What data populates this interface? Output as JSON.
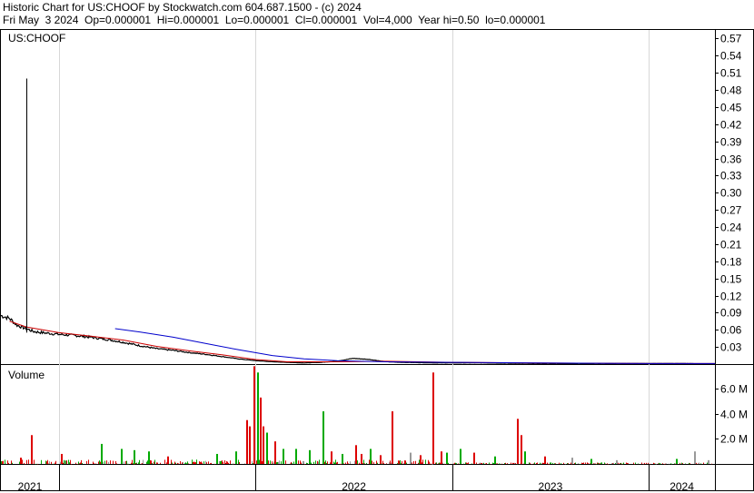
{
  "header": {
    "line1": "Historic Chart for US:CHOOF by Stockwatch.com 604.687.1500 - (c) 2024",
    "line2": "Fri May  3 2024  Op=0.000001  Hi=0.000001  Lo=0.000001  Cl=0.000001  Vol=4,000  Year hi=0.50  lo=0.000001"
  },
  "chart_data": [
    {
      "type": "line",
      "panel": "price",
      "label": "US:CHOOF",
      "ylim": [
        0,
        0.585
      ],
      "yticks": [
        "0.57",
        "0.54",
        "0.51",
        "0.48",
        "0.45",
        "0.42",
        "0.39",
        "0.36",
        "0.33",
        "0.30",
        "0.27",
        "0.24",
        "0.21",
        "0.18",
        "0.15",
        "0.12",
        "0.09",
        "0.06",
        "0.03"
      ],
      "ytick_values": [
        0.57,
        0.54,
        0.51,
        0.48,
        0.45,
        0.42,
        0.39,
        0.36,
        0.33,
        0.3,
        0.27,
        0.24,
        0.21,
        0.18,
        0.15,
        0.12,
        0.09,
        0.06,
        0.03
      ],
      "xlim": [
        "2020-09-15",
        "2024-05-03"
      ],
      "spike": {
        "x": "2020-11-02",
        "low": 0.055,
        "high": 0.5
      },
      "series": [
        {
          "name": "",
          "color": "#000000",
          "x": [
            "2020-09-15",
            "2020-10-01",
            "2020-10-15",
            "2020-11-01",
            "2020-11-15",
            "2020-12-01",
            "2021-01-01",
            "2021-02-01",
            "2021-03-01",
            "2021-04-01",
            "2021-05-01",
            "2021-06-01",
            "2021-07-01",
            "2021-08-01",
            "2021-09-01",
            "2021-10-01",
            "2021-11-01",
            "2021-12-01",
            "2022-01-01",
            "2022-02-01",
            "2022-03-01",
            "2022-04-01",
            "2022-05-01",
            "2022-06-01",
            "2022-07-01",
            "2022-08-01",
            "2022-09-01",
            "2022-10-01",
            "2022-12-01",
            "2023-03-01",
            "2023-06-01",
            "2023-09-01",
            "2023-12-01",
            "2024-03-01",
            "2024-05-03"
          ],
          "values": [
            0.085,
            0.08,
            0.068,
            0.062,
            0.057,
            0.055,
            0.052,
            0.05,
            0.047,
            0.043,
            0.038,
            0.032,
            0.027,
            0.024,
            0.02,
            0.017,
            0.013,
            0.009,
            0.006,
            0.004,
            0.003,
            0.002,
            0.003,
            0.005,
            0.01,
            0.008,
            0.004,
            0.003,
            0.002,
            0.002,
            0.001,
            0.001,
            0.001,
            0.001,
            1e-06
          ]
        },
        {
          "name": "",
          "color": "#cc0000",
          "x": [
            "2020-10-01",
            "2020-11-01",
            "2021-01-01",
            "2021-03-01",
            "2021-05-01",
            "2021-07-01",
            "2021-09-01",
            "2021-11-01",
            "2022-01-01",
            "2022-03-01",
            "2022-06-01",
            "2022-09-01",
            "2023-01-01",
            "2023-06-01",
            "2024-01-01",
            "2024-05-03"
          ],
          "values": [
            0.075,
            0.065,
            0.055,
            0.049,
            0.042,
            0.031,
            0.023,
            0.016,
            0.008,
            0.004,
            0.004,
            0.005,
            0.003,
            0.002,
            0.001,
            0.001
          ]
        },
        {
          "name": "",
          "color": "#0000cc",
          "x": [
            "2021-04-15",
            "2021-06-01",
            "2021-08-01",
            "2021-10-01",
            "2021-12-01",
            "2022-02-01",
            "2022-04-01",
            "2022-06-01",
            "2022-09-01",
            "2023-01-01",
            "2023-06-01",
            "2024-01-01",
            "2024-05-03"
          ],
          "values": [
            0.062,
            0.056,
            0.047,
            0.036,
            0.025,
            0.015,
            0.009,
            0.006,
            0.004,
            0.003,
            0.002,
            0.001,
            0.001
          ]
        }
      ]
    },
    {
      "type": "bar",
      "panel": "volume",
      "label": "Volume",
      "ylim": [
        0,
        7.9
      ],
      "unit": "M",
      "yticks": [
        "6.0 M",
        "4.0 M",
        "2.0 M"
      ],
      "ytick_values": [
        6.0,
        4.0,
        2.0
      ],
      "xlim": [
        "2020-09-15",
        "2024-05-03"
      ],
      "colors": {
        "up": "#00aa00",
        "down": "#dd0000",
        "flat": "#999999"
      },
      "peaks": [
        {
          "x": "2020-10-20",
          "v": 0.5,
          "c": "down"
        },
        {
          "x": "2020-11-10",
          "v": 2.3,
          "c": "down"
        },
        {
          "x": "2021-01-05",
          "v": 0.8,
          "c": "down"
        },
        {
          "x": "2021-03-20",
          "v": 1.6,
          "c": "up"
        },
        {
          "x": "2021-04-25",
          "v": 1.2,
          "c": "up"
        },
        {
          "x": "2021-05-20",
          "v": 1.1,
          "c": "up"
        },
        {
          "x": "2021-06-15",
          "v": 1.0,
          "c": "up"
        },
        {
          "x": "2021-07-20",
          "v": 0.6,
          "c": "down"
        },
        {
          "x": "2021-10-20",
          "v": 0.8,
          "c": "up"
        },
        {
          "x": "2021-11-25",
          "v": 1.0,
          "c": "up"
        },
        {
          "x": "2021-12-15",
          "v": 3.5,
          "c": "down"
        },
        {
          "x": "2021-12-20",
          "v": 3.0,
          "c": "down"
        },
        {
          "x": "2021-12-28",
          "v": 7.8,
          "c": "down"
        },
        {
          "x": "2022-01-03",
          "v": 7.3,
          "c": "up"
        },
        {
          "x": "2022-01-08",
          "v": 5.3,
          "c": "down"
        },
        {
          "x": "2022-01-14",
          "v": 3.0,
          "c": "down"
        },
        {
          "x": "2022-01-20",
          "v": 2.5,
          "c": "up"
        },
        {
          "x": "2022-02-05",
          "v": 1.8,
          "c": "down"
        },
        {
          "x": "2022-02-20",
          "v": 1.2,
          "c": "up"
        },
        {
          "x": "2022-03-15",
          "v": 1.2,
          "c": "up"
        },
        {
          "x": "2022-04-10",
          "v": 1.1,
          "c": "up"
        },
        {
          "x": "2022-05-05",
          "v": 4.2,
          "c": "up"
        },
        {
          "x": "2022-05-20",
          "v": 1.0,
          "c": "down"
        },
        {
          "x": "2022-06-10",
          "v": 0.8,
          "c": "up"
        },
        {
          "x": "2022-07-05",
          "v": 1.5,
          "c": "down"
        },
        {
          "x": "2022-07-15",
          "v": 0.8,
          "c": "down"
        },
        {
          "x": "2022-08-01",
          "v": 1.2,
          "c": "up"
        },
        {
          "x": "2022-08-20",
          "v": 0.7,
          "c": "down"
        },
        {
          "x": "2022-09-10",
          "v": 4.2,
          "c": "down"
        },
        {
          "x": "2022-10-15",
          "v": 0.9,
          "c": "flat"
        },
        {
          "x": "2022-11-01",
          "v": 0.7,
          "c": "down"
        },
        {
          "x": "2022-11-25",
          "v": 7.3,
          "c": "down"
        },
        {
          "x": "2022-12-10",
          "v": 1.0,
          "c": "down"
        },
        {
          "x": "2022-12-20",
          "v": 0.9,
          "c": "up"
        },
        {
          "x": "2023-01-15",
          "v": 1.2,
          "c": "up"
        },
        {
          "x": "2023-02-10",
          "v": 0.9,
          "c": "down"
        },
        {
          "x": "2023-03-20",
          "v": 0.6,
          "c": "up"
        },
        {
          "x": "2023-05-01",
          "v": 3.6,
          "c": "down"
        },
        {
          "x": "2023-05-08",
          "v": 2.3,
          "c": "down"
        },
        {
          "x": "2023-05-15",
          "v": 1.0,
          "c": "up"
        },
        {
          "x": "2023-06-20",
          "v": 0.6,
          "c": "down"
        },
        {
          "x": "2023-08-10",
          "v": 0.5,
          "c": "flat"
        },
        {
          "x": "2023-09-15",
          "v": 0.4,
          "c": "up"
        },
        {
          "x": "2023-11-01",
          "v": 0.3,
          "c": "flat"
        },
        {
          "x": "2024-02-20",
          "v": 0.4,
          "c": "up"
        },
        {
          "x": "2024-03-25",
          "v": 1.0,
          "c": "flat"
        },
        {
          "x": "2024-04-20",
          "v": 0.3,
          "c": "flat"
        }
      ]
    }
  ],
  "x_axis": {
    "year_labels": [
      "2021",
      "2022",
      "2023",
      "2024"
    ],
    "year_starts": [
      "2021-01-01",
      "2022-01-01",
      "2023-01-01",
      "2024-01-01"
    ]
  }
}
